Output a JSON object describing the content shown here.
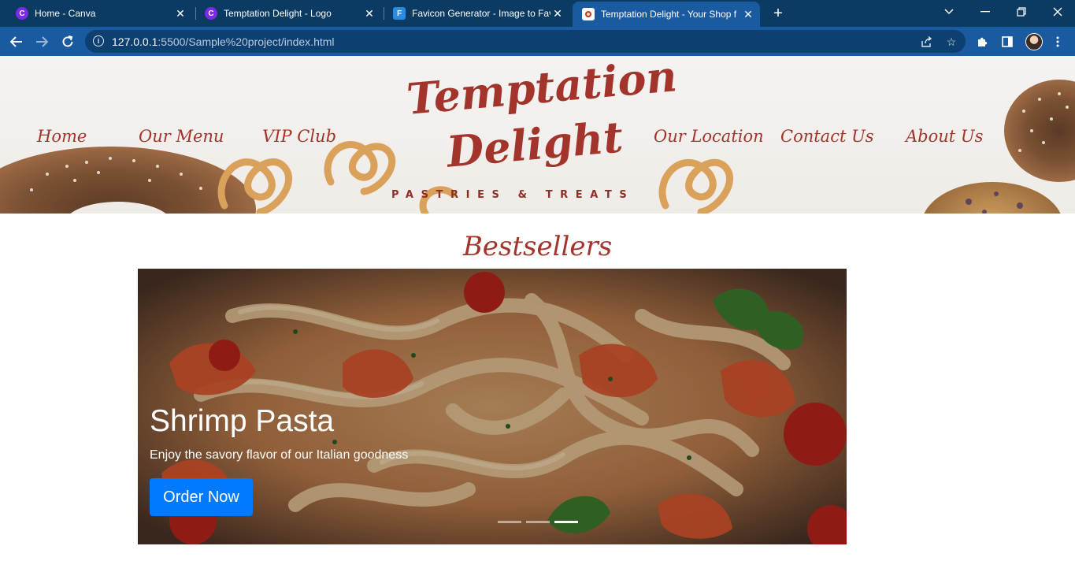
{
  "browser": {
    "tabs": [
      {
        "title": "Home - Canva",
        "favicon": "canva-icon",
        "color": "#7d2ae8",
        "glyph": "C",
        "active": false
      },
      {
        "title": "Temptation Delight - Logo",
        "favicon": "canva-icon",
        "color": "#7d2ae8",
        "glyph": "C",
        "active": false
      },
      {
        "title": "Favicon Generator - Image to Fav",
        "favicon": "favicon-generator-icon",
        "color": "#2a8ce0",
        "glyph": "F",
        "active": false
      },
      {
        "title": "Temptation Delight - Your Shop f",
        "favicon": "site-favicon-icon",
        "color": "#ffffff",
        "glyph": "",
        "active": true
      }
    ],
    "address": {
      "host": "127.0.0.1",
      "path": ":5500/Sample%20project/index.html"
    },
    "colors": {
      "frame": "#0b3a63",
      "toolbar": "#1a5aa0"
    }
  },
  "site": {
    "nav_left": [
      "Home",
      "Our Menu",
      "VIP Club"
    ],
    "nav_right": [
      "Our Location",
      "Contact Us",
      "About Us"
    ],
    "logo": {
      "line1": "Temptation",
      "line2": "Delight",
      "tagline": "PASTRIES & TREATS"
    },
    "brand_color": "#a2342c",
    "section_title": "Bestsellers",
    "carousel": {
      "slide_title": "Shrimp Pasta",
      "slide_text": "Enjoy the savory flavor of our Italian goodness",
      "button_label": "Order Now",
      "button_color": "#007bff",
      "slide_count": 3,
      "active_index": 2
    }
  }
}
